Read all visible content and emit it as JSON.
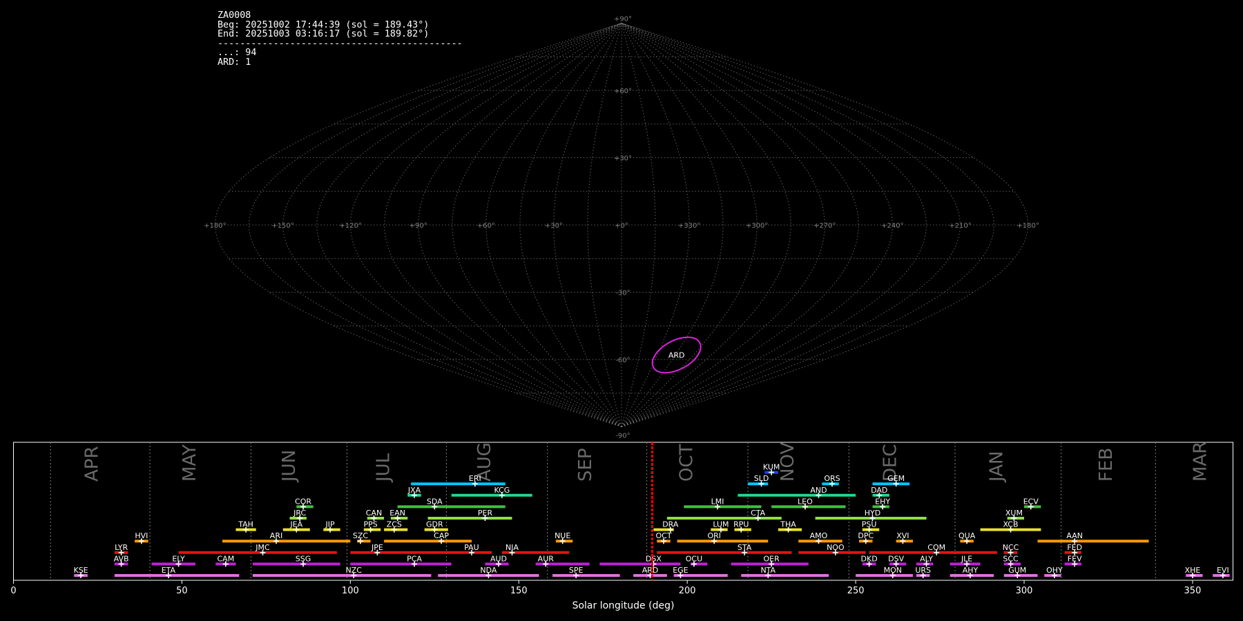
{
  "info": {
    "station_id": "ZA0008",
    "begin": "Beg: 20251002 17:44:39 (sol = 189.43°)",
    "end": "End: 20251003 03:16:17 (sol = 189.82°)",
    "separator": "--------------------------------------------",
    "count_sporadic": "...: 94",
    "count_shower": "ARD: 1"
  },
  "colors": {
    "background": "#000000",
    "grid": "#808080",
    "text": "#ffffff",
    "current_marker": "#ff0000",
    "highlight_shower": "#e020e0"
  },
  "chart_data": [
    {
      "type": "scatter",
      "projection": "sinusoidal-sky-map",
      "grid": true,
      "lon_ticks": [
        "+180°",
        "+150°",
        "+120°",
        "+90°",
        "+60°",
        "+30°",
        "+0°",
        "+330°",
        "+300°",
        "+270°",
        "+240°",
        "+210°",
        "+180°"
      ],
      "lat_ticks": [
        "+90°",
        "+60°",
        "+30°",
        "-30°",
        "-60°",
        "-90°"
      ],
      "radiant": {
        "code": "ARD",
        "lon": 314,
        "lat": -58,
        "color": "#e020e0"
      }
    },
    {
      "type": "bar",
      "xlabel": "Solar longitude (deg)",
      "xlim": [
        0,
        362
      ],
      "xticks": [
        0,
        50,
        100,
        150,
        200,
        250,
        300,
        350
      ],
      "grid": true,
      "current_sol": 189.6,
      "months": [
        {
          "name": "APR",
          "boundary": 11,
          "label_at": 25
        },
        {
          "name": "MAY",
          "boundary": 40.5,
          "label_at": 54
        },
        {
          "name": "JUN",
          "boundary": 70.5,
          "label_at": 83.5
        },
        {
          "name": "JUL",
          "boundary": 99,
          "label_at": 111.5
        },
        {
          "name": "AUG",
          "boundary": 128.5,
          "label_at": 141.5
        },
        {
          "name": "SEP",
          "boundary": 158.5,
          "label_at": 171.5
        },
        {
          "name": "OCT",
          "boundary": 188,
          "label_at": 201.5
        },
        {
          "name": "NOV",
          "boundary": 218,
          "label_at": 231.5
        },
        {
          "name": "DEC",
          "boundary": 248,
          "label_at": 262
        },
        {
          "name": "JAN",
          "boundary": 279.5,
          "label_at": 293.5
        },
        {
          "name": "FEB",
          "boundary": 311,
          "label_at": 326
        },
        {
          "name": "MAR",
          "boundary": 339,
          "label_at": 354
        }
      ],
      "showers": [
        {
          "code": "KUM",
          "start": 223,
          "end": 227,
          "peak": 225,
          "row": 10,
          "color": "#2040ff"
        },
        {
          "code": "ERI",
          "start": 118,
          "end": 146,
          "peak": 137,
          "row": 9,
          "color": "#00c8ff"
        },
        {
          "code": "SLD",
          "start": 218,
          "end": 224,
          "peak": 222,
          "row": 9,
          "color": "#00c8ff"
        },
        {
          "code": "ORS",
          "start": 240,
          "end": 245,
          "peak": 243,
          "row": 9,
          "color": "#00c8ff"
        },
        {
          "code": "GEM",
          "start": 255,
          "end": 266,
          "peak": 262,
          "row": 9,
          "color": "#00c8ff"
        },
        {
          "code": "JXA",
          "start": 117,
          "end": 121,
          "peak": 119,
          "row": 8,
          "color": "#20d890"
        },
        {
          "code": "KCG",
          "start": 130,
          "end": 154,
          "peak": 145,
          "row": 8,
          "color": "#20d890"
        },
        {
          "code": "AND",
          "start": 215,
          "end": 250,
          "peak": 239,
          "row": 8,
          "color": "#20d890"
        },
        {
          "code": "DAD",
          "start": 255,
          "end": 260,
          "peak": 257,
          "row": 8,
          "color": "#20d890"
        },
        {
          "code": "COR",
          "start": 84,
          "end": 89,
          "peak": 86,
          "row": 7,
          "color": "#40c040"
        },
        {
          "code": "SDA",
          "start": 114,
          "end": 146,
          "peak": 125,
          "row": 7,
          "color": "#40c040"
        },
        {
          "code": "LMI",
          "start": 199,
          "end": 222,
          "peak": 209,
          "row": 7,
          "color": "#40c040"
        },
        {
          "code": "LEO",
          "start": 225,
          "end": 247,
          "peak": 235,
          "row": 7,
          "color": "#40c040"
        },
        {
          "code": "EHY",
          "start": 255,
          "end": 260,
          "peak": 258,
          "row": 7,
          "color": "#40c040"
        },
        {
          "code": "ECV",
          "start": 300,
          "end": 305,
          "peak": 302,
          "row": 7,
          "color": "#40c040"
        },
        {
          "code": "JRC",
          "start": 82,
          "end": 87,
          "peak": 85,
          "row": 6,
          "color": "#90e040"
        },
        {
          "code": "CAN",
          "start": 105,
          "end": 110,
          "peak": 107,
          "row": 6,
          "color": "#90e040"
        },
        {
          "code": "EAN",
          "start": 112,
          "end": 117,
          "peak": 114,
          "row": 6,
          "color": "#90e040"
        },
        {
          "code": "PER",
          "start": 123,
          "end": 148,
          "peak": 140,
          "row": 6,
          "color": "#90e040"
        },
        {
          "code": "CTA",
          "start": 194,
          "end": 228,
          "peak": 221,
          "row": 6,
          "color": "#90e040"
        },
        {
          "code": "HYD",
          "start": 238,
          "end": 271,
          "peak": 255,
          "row": 6,
          "color": "#90e040"
        },
        {
          "code": "XUM",
          "start": 295,
          "end": 300,
          "peak": 297,
          "row": 6,
          "color": "#90e040"
        },
        {
          "code": "TAH",
          "start": 66,
          "end": 72,
          "peak": 69,
          "row": 5,
          "color": "#e8e030"
        },
        {
          "code": "JEA",
          "start": 80,
          "end": 88,
          "peak": 84,
          "row": 5,
          "color": "#e8e030"
        },
        {
          "code": "JIP",
          "start": 92,
          "end": 97,
          "peak": 94,
          "row": 5,
          "color": "#e8e030"
        },
        {
          "code": "PPS",
          "start": 104,
          "end": 109,
          "peak": 106,
          "row": 5,
          "color": "#e8e030"
        },
        {
          "code": "ZCS",
          "start": 110,
          "end": 117,
          "peak": 113,
          "row": 5,
          "color": "#e8e030"
        },
        {
          "code": "GDR",
          "start": 122,
          "end": 129,
          "peak": 125,
          "row": 5,
          "color": "#e8e030"
        },
        {
          "code": "DRA",
          "start": 190,
          "end": 196,
          "peak": 195,
          "row": 5,
          "color": "#e8e030"
        },
        {
          "code": "LUM",
          "start": 207,
          "end": 212,
          "peak": 210,
          "row": 5,
          "color": "#e8e030"
        },
        {
          "code": "RPU",
          "start": 214,
          "end": 219,
          "peak": 216,
          "row": 5,
          "color": "#e8e030"
        },
        {
          "code": "THA",
          "start": 227,
          "end": 234,
          "peak": 230,
          "row": 5,
          "color": "#e8e030"
        },
        {
          "code": "PSU",
          "start": 252,
          "end": 257,
          "peak": 254,
          "row": 5,
          "color": "#e8e030"
        },
        {
          "code": "XCB",
          "start": 287,
          "end": 305,
          "peak": 296,
          "row": 5,
          "color": "#e8e030"
        },
        {
          "code": "HVI",
          "start": 36,
          "end": 40,
          "peak": 38,
          "row": 4,
          "color": "#ff9a00"
        },
        {
          "code": "ARI",
          "start": 62,
          "end": 100,
          "peak": 78,
          "row": 4,
          "color": "#ff9a00"
        },
        {
          "code": "SZC",
          "start": 102,
          "end": 106,
          "peak": 103,
          "row": 4,
          "color": "#ff9a00"
        },
        {
          "code": "CAP",
          "start": 110,
          "end": 136,
          "peak": 127,
          "row": 4,
          "color": "#ff9a00"
        },
        {
          "code": "NUE",
          "start": 161,
          "end": 166,
          "peak": 163,
          "row": 4,
          "color": "#ff9a00"
        },
        {
          "code": "OCT",
          "start": 191,
          "end": 195,
          "peak": 193,
          "row": 4,
          "color": "#ff9a00"
        },
        {
          "code": "ORI",
          "start": 197,
          "end": 224,
          "peak": 208,
          "row": 4,
          "color": "#ff9a00"
        },
        {
          "code": "AMO",
          "start": 233,
          "end": 246,
          "peak": 239,
          "row": 4,
          "color": "#ff9a00"
        },
        {
          "code": "DPC",
          "start": 251,
          "end": 255,
          "peak": 253,
          "row": 4,
          "color": "#ff9a00"
        },
        {
          "code": "XVI",
          "start": 262,
          "end": 267,
          "peak": 264,
          "row": 4,
          "color": "#ff9a00"
        },
        {
          "code": "QUA",
          "start": 281,
          "end": 285,
          "peak": 283,
          "row": 4,
          "color": "#ff9a00"
        },
        {
          "code": "AAN",
          "start": 304,
          "end": 337,
          "peak": 315,
          "row": 4,
          "color": "#ff9a00"
        },
        {
          "code": "LYR",
          "start": 30,
          "end": 34,
          "peak": 32,
          "row": 3,
          "color": "#e81010"
        },
        {
          "code": "JMC",
          "start": 49,
          "end": 96,
          "peak": 74,
          "row": 3,
          "color": "#e81010"
        },
        {
          "code": "JPE",
          "start": 100,
          "end": 122,
          "peak": 108,
          "row": 3,
          "color": "#e81010"
        },
        {
          "code": "PAU",
          "start": 122,
          "end": 142,
          "peak": 136,
          "row": 3,
          "color": "#e81010"
        },
        {
          "code": "NIA",
          "start": 145,
          "end": 165,
          "peak": 148,
          "row": 3,
          "color": "#e81010"
        },
        {
          "code": "STA",
          "start": 191,
          "end": 231,
          "peak": 217,
          "row": 3,
          "color": "#e81010"
        },
        {
          "code": "NOO",
          "start": 233,
          "end": 253,
          "peak": 244,
          "row": 3,
          "color": "#e81010"
        },
        {
          "code": "COM",
          "start": 254,
          "end": 292,
          "peak": 274,
          "row": 3,
          "color": "#e81010"
        },
        {
          "code": "NCC",
          "start": 294,
          "end": 298,
          "peak": 296,
          "row": 3,
          "color": "#e81010"
        },
        {
          "code": "FED",
          "start": 312,
          "end": 317,
          "peak": 315,
          "row": 3,
          "color": "#e81010"
        },
        {
          "code": "AVB",
          "start": 30,
          "end": 34,
          "peak": 32,
          "row": 2,
          "color": "#c020d8"
        },
        {
          "code": "ELY",
          "start": 41,
          "end": 54,
          "peak": 49,
          "row": 2,
          "color": "#c020d8"
        },
        {
          "code": "CAM",
          "start": 60,
          "end": 66,
          "peak": 63,
          "row": 2,
          "color": "#c020d8"
        },
        {
          "code": "SSG",
          "start": 71,
          "end": 97,
          "peak": 86,
          "row": 2,
          "color": "#c020d8"
        },
        {
          "code": "PCA",
          "start": 100,
          "end": 130,
          "peak": 119,
          "row": 2,
          "color": "#c020d8"
        },
        {
          "code": "AUD",
          "start": 140,
          "end": 147,
          "peak": 144,
          "row": 2,
          "color": "#c020d8"
        },
        {
          "code": "AUR",
          "start": 155,
          "end": 171,
          "peak": 158,
          "row": 2,
          "color": "#c020d8"
        },
        {
          "code": "DSX",
          "start": 174,
          "end": 198,
          "peak": 190,
          "row": 2,
          "color": "#c020d8"
        },
        {
          "code": "OCU",
          "start": 201,
          "end": 206,
          "peak": 202,
          "row": 2,
          "color": "#c020d8"
        },
        {
          "code": "OER",
          "start": 213,
          "end": 236,
          "peak": 225,
          "row": 2,
          "color": "#c020d8"
        },
        {
          "code": "DKD",
          "start": 252,
          "end": 256,
          "peak": 254,
          "row": 2,
          "color": "#c020d8"
        },
        {
          "code": "DSV",
          "start": 260,
          "end": 265,
          "peak": 262,
          "row": 2,
          "color": "#c020d8"
        },
        {
          "code": "ALY",
          "start": 268,
          "end": 273,
          "peak": 271,
          "row": 2,
          "color": "#c020d8"
        },
        {
          "code": "JLE",
          "start": 278,
          "end": 287,
          "peak": 283,
          "row": 2,
          "color": "#c020d8"
        },
        {
          "code": "SCC",
          "start": 294,
          "end": 299,
          "peak": 296,
          "row": 2,
          "color": "#c020d8"
        },
        {
          "code": "FEV",
          "start": 312,
          "end": 317,
          "peak": 315,
          "row": 2,
          "color": "#c020d8"
        },
        {
          "code": "KSE",
          "start": 18,
          "end": 22,
          "peak": 20,
          "row": 1,
          "color": "#e070e0"
        },
        {
          "code": "ETA",
          "start": 30,
          "end": 67,
          "peak": 46,
          "row": 1,
          "color": "#e070e0"
        },
        {
          "code": "NZC",
          "start": 71,
          "end": 124,
          "peak": 101,
          "row": 1,
          "color": "#e070e0"
        },
        {
          "code": "NDA",
          "start": 126,
          "end": 156,
          "peak": 141,
          "row": 1,
          "color": "#e070e0"
        },
        {
          "code": "SPE",
          "start": 160,
          "end": 180,
          "peak": 167,
          "row": 1,
          "color": "#e070e0"
        },
        {
          "code": "ARD",
          "start": 184,
          "end": 194,
          "peak": 189,
          "row": 1,
          "color": "#e070e0"
        },
        {
          "code": "EGE",
          "start": 196,
          "end": 212,
          "peak": 198,
          "row": 1,
          "color": "#e070e0"
        },
        {
          "code": "NTA",
          "start": 216,
          "end": 242,
          "peak": 224,
          "row": 1,
          "color": "#e070e0"
        },
        {
          "code": "MON",
          "start": 250,
          "end": 267,
          "peak": 261,
          "row": 1,
          "color": "#e070e0"
        },
        {
          "code": "URS",
          "start": 268,
          "end": 272,
          "peak": 270,
          "row": 1,
          "color": "#e070e0"
        },
        {
          "code": "AHY",
          "start": 278,
          "end": 291,
          "peak": 284,
          "row": 1,
          "color": "#e070e0"
        },
        {
          "code": "GUM",
          "start": 294,
          "end": 304,
          "peak": 298,
          "row": 1,
          "color": "#e070e0"
        },
        {
          "code": "OHY",
          "start": 306,
          "end": 311,
          "peak": 309,
          "row": 1,
          "color": "#e070e0"
        },
        {
          "code": "XHE",
          "start": 348,
          "end": 353,
          "peak": 350,
          "row": 1,
          "color": "#e070e0"
        },
        {
          "code": "EVI",
          "start": 356,
          "end": 361,
          "peak": 359,
          "row": 1,
          "color": "#e070e0"
        }
      ]
    }
  ]
}
